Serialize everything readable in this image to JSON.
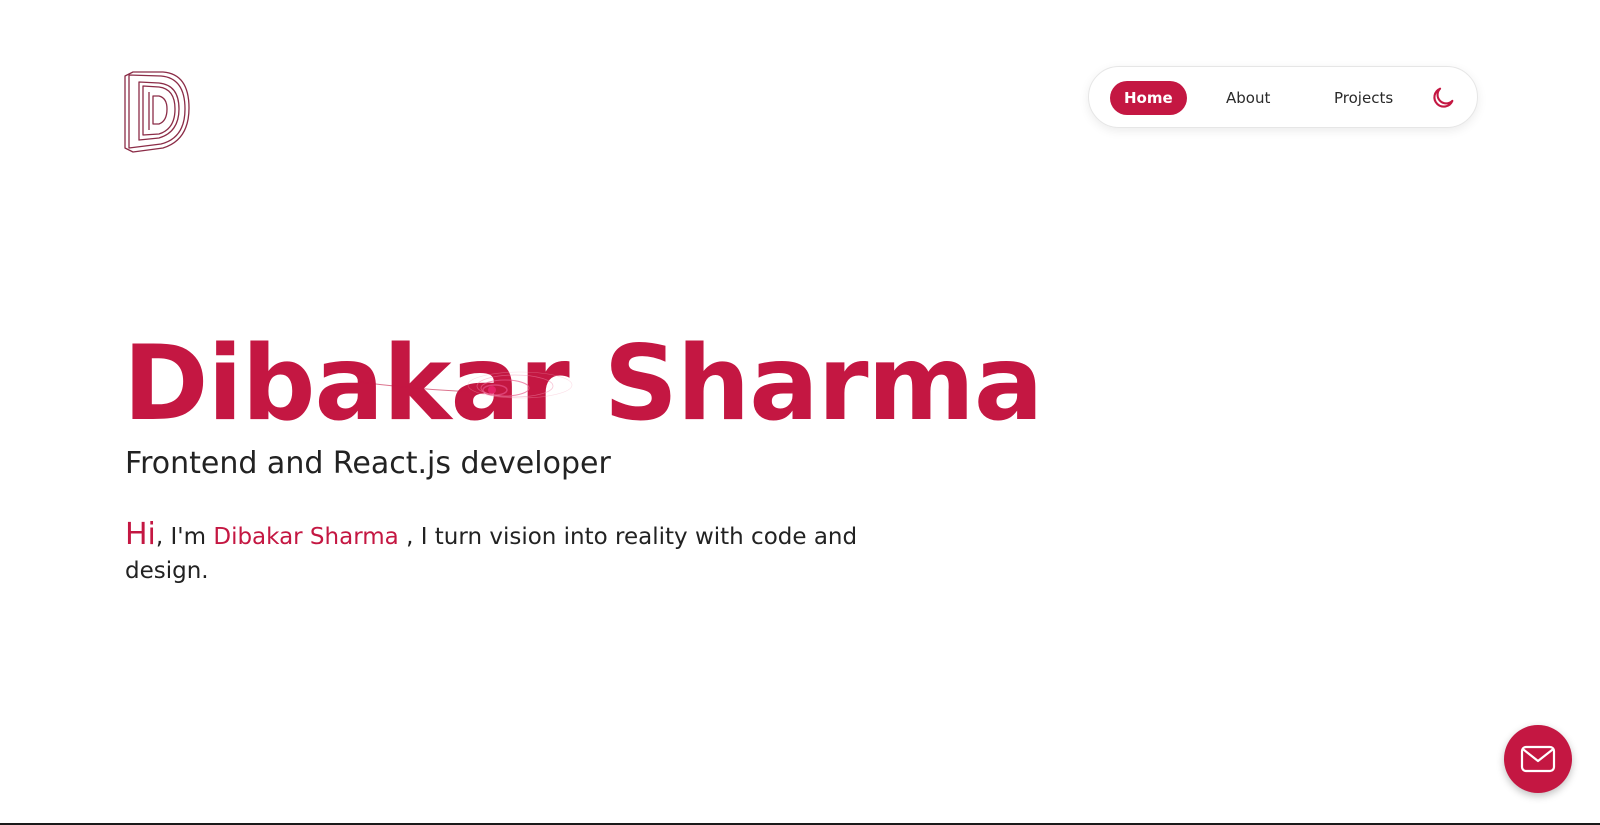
{
  "header": {
    "logo_icon": "d-monogram-logo-icon",
    "nav": {
      "items": [
        {
          "label": "Home",
          "active": true
        },
        {
          "label": "About",
          "active": false
        },
        {
          "label": "Projects",
          "active": false
        }
      ],
      "theme_toggle_icon": "moon-icon"
    }
  },
  "hero": {
    "name": "Dibakar Sharma",
    "role": "Frontend and React.js developer",
    "intro": {
      "hi": "Hi",
      "lead": ", I'm ",
      "name": "Dibakar Sharma",
      "rest": " , I turn vision into reality with code and design."
    }
  },
  "floating": {
    "mail_icon": "mail-icon"
  },
  "colors": {
    "accent": "#c41742",
    "text": "#222222",
    "background": "#ffffff"
  }
}
